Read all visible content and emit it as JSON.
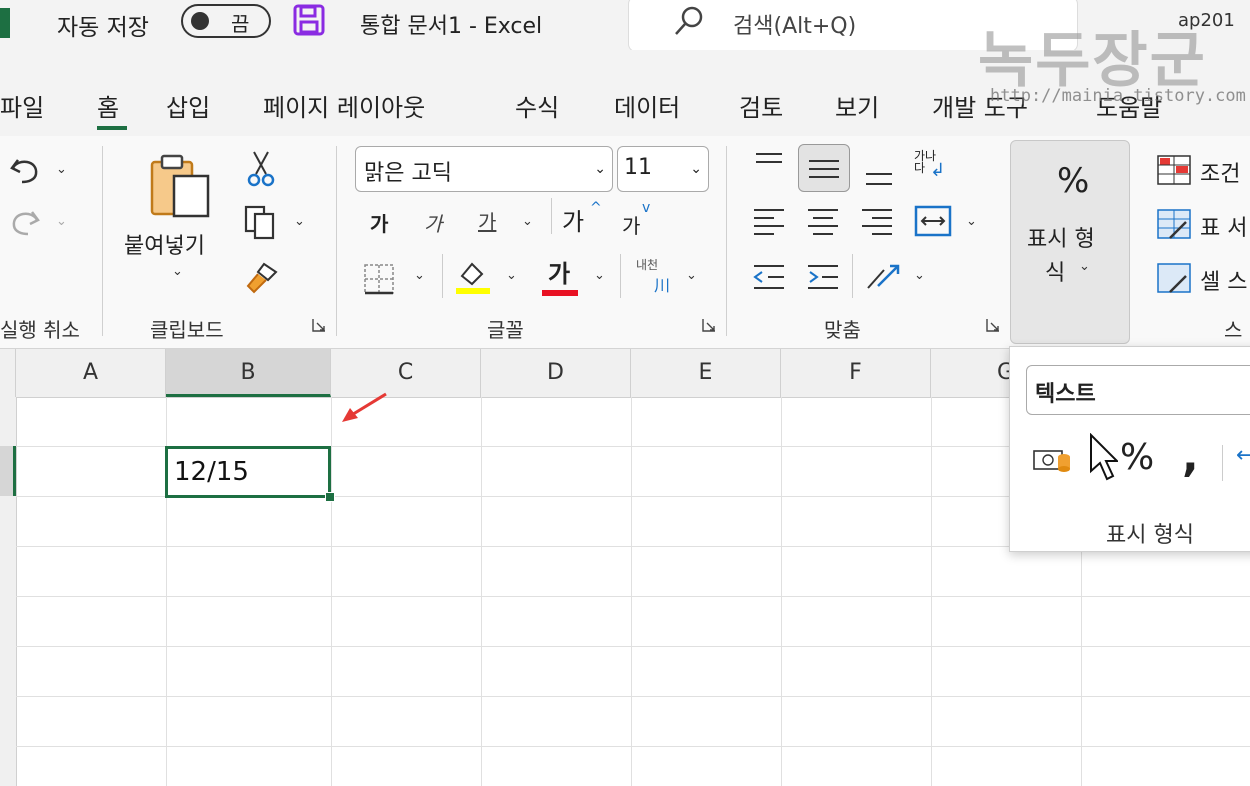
{
  "titlebar": {
    "autosave_label": "자동 저장",
    "toggle_label": "끔",
    "doc_title": "통합 문서1  -  Excel",
    "search_placeholder": "검색(Alt+Q)",
    "user": "ap201"
  },
  "watermark": {
    "text": "녹두장군",
    "url": "http://mainia.tistory.com"
  },
  "tabs": [
    "파일",
    "홈",
    "삽입",
    "페이지 레이아웃",
    "수식",
    "데이터",
    "검토",
    "보기",
    "개발 도구",
    "도움말"
  ],
  "ribbon": {
    "groups": {
      "undo": "실행 취소",
      "clipboard": "클립보드",
      "font": "글꼴",
      "alignment": "맞춤",
      "styles": "스"
    },
    "paste_label": "붙여넣기",
    "font_name": "맑은 고딕",
    "font_size": "11",
    "bold_label": "가",
    "italic_label": "가",
    "underline_label": "가",
    "grow_font_label": "가",
    "shrink_font_label": "가",
    "font_color_label": "가",
    "phonetic_label": "내천",
    "wrap_label": "가나\n다",
    "number_format": {
      "symbol": "%",
      "label_line1": "표시 형",
      "label_line2": "식"
    },
    "styles_items": [
      "조건",
      "표 서",
      "셀 스"
    ]
  },
  "grid": {
    "columns": [
      "A",
      "B",
      "C",
      "D",
      "E",
      "F",
      "G"
    ],
    "cell_b2_value": "12/15"
  },
  "panel": {
    "format_value": "텍스트",
    "title": "표시 형식",
    "percent_symbol": "%",
    "comma_symbol": ","
  },
  "colors": {
    "excel_green": "#1d6f42",
    "highlight_yellow": "#ffff00",
    "font_red": "#e81123",
    "annotation_red": "#e53935"
  }
}
